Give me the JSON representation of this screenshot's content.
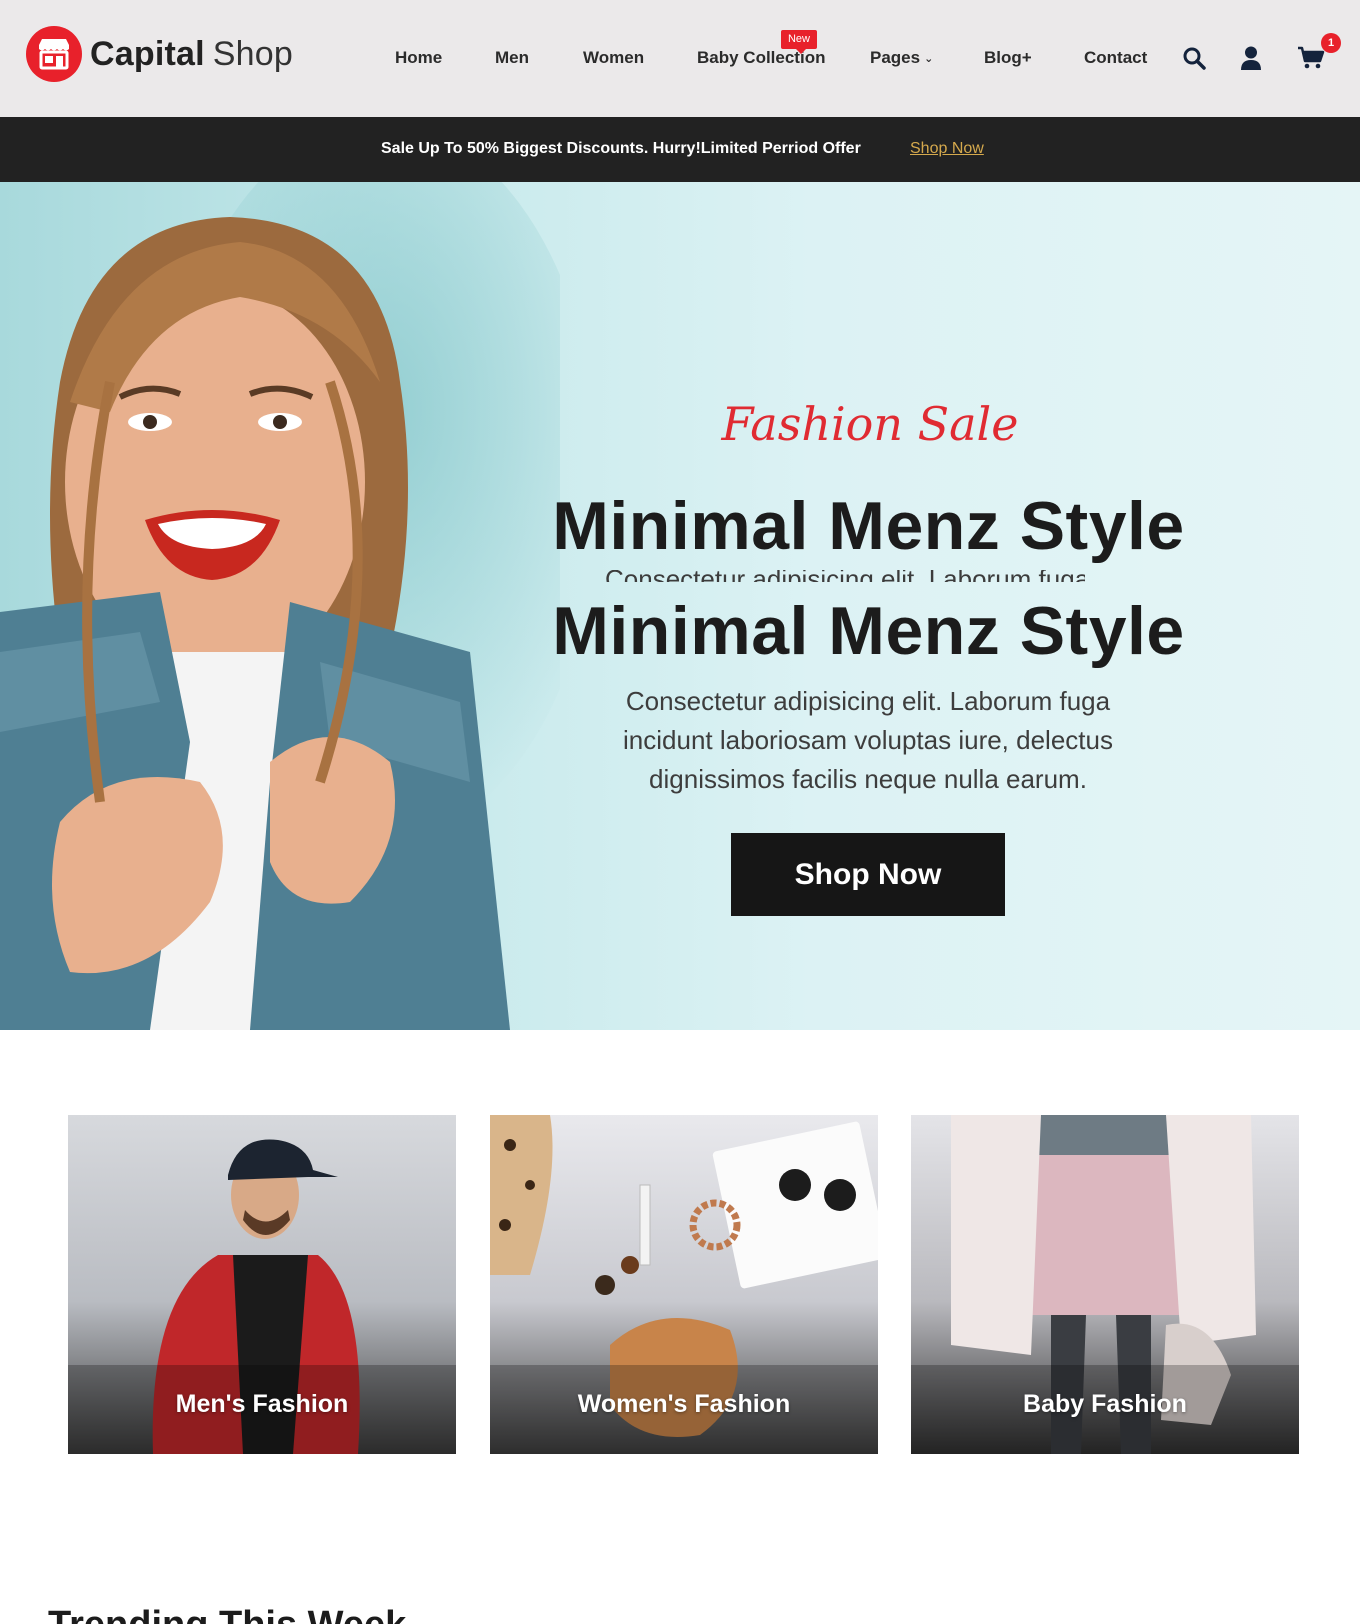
{
  "brand": {
    "name_bold": "Capital",
    "name_light": "Shop",
    "icon": "storefront-icon",
    "accent": "#e8212b"
  },
  "nav": {
    "items": [
      {
        "label": "Home"
      },
      {
        "label": "Men"
      },
      {
        "label": "Women"
      },
      {
        "label": "Baby Collection",
        "badge": "New"
      },
      {
        "label": "Pages",
        "dropdown": true
      },
      {
        "label": "Blog+"
      },
      {
        "label": "Contact"
      }
    ],
    "icons": [
      "search-icon",
      "user-icon",
      "cart-icon"
    ],
    "cart_count": "1"
  },
  "promo": {
    "text": "Sale Up To 50% Biggest Discounts. Hurry!Limited Perriod Offer",
    "link": "Shop Now",
    "background": "#222222",
    "link_color": "#d5a94d"
  },
  "hero": {
    "subtitle": "Fashion Sale",
    "title": "Minimal Menz Style",
    "title_repeat": "Minimal Menz Style",
    "description": "Consectetur adipisicing elit. Laborum fuga incidunt laboriosam voluptas iure, delectus dignissimos facilis neque nulla earum.",
    "button": "Shop Now",
    "subtitle_color": "#e02b32"
  },
  "categories": [
    {
      "label": "Men's Fashion"
    },
    {
      "label": "Women's Fashion"
    },
    {
      "label": "Baby Fashion"
    }
  ],
  "section": {
    "title": "Trending This Week"
  }
}
